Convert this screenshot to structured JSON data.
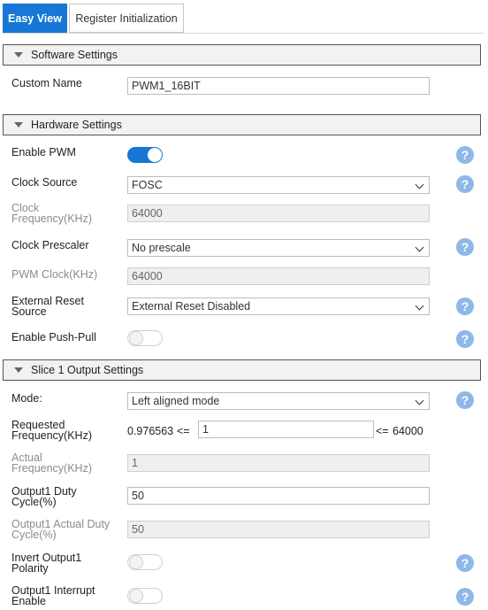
{
  "tabs": [
    {
      "label": "Easy View"
    },
    {
      "label": "Register Initialization"
    }
  ],
  "software": {
    "title": "Software Settings",
    "custom_name_label": "Custom Name",
    "custom_name_value": "PWM1_16BIT"
  },
  "hardware": {
    "title": "Hardware Settings",
    "enable_pwm_label": "Enable PWM",
    "enable_pwm_on": true,
    "clock_source_label": "Clock Source",
    "clock_source_value": "FOSC",
    "clock_freq_label_1": "Clock",
    "clock_freq_label_2": "Frequency(KHz)",
    "clock_freq_value": "64000",
    "clock_prescaler_label": "Clock Prescaler",
    "clock_prescaler_value": "No prescale",
    "pwm_clock_label": "PWM Clock(KHz)",
    "pwm_clock_value": "64000",
    "ext_reset_label_1": "External Reset",
    "ext_reset_label_2": "Source",
    "ext_reset_value": "External Reset Disabled",
    "push_pull_label": "Enable Push-Pull",
    "push_pull_on": false
  },
  "slice1": {
    "title": "Slice 1 Output Settings",
    "mode_label": "Mode:",
    "mode_value": "Left aligned mode",
    "req_freq_label_1": "Requested",
    "req_freq_label_2": "Frequency(KHz)",
    "req_freq_min": "0.976563",
    "req_freq_le1": "<=",
    "req_freq_value": "1",
    "req_freq_le2": "<=",
    "req_freq_max": "64000",
    "actual_freq_label_1": "Actual",
    "actual_freq_label_2": "Frequency(KHz)",
    "actual_freq_value": "1",
    "duty_label_1": "Output1 Duty",
    "duty_label_2": "Cycle(%)",
    "duty_value": "50",
    "actual_duty_label_1": "Output1 Actual Duty",
    "actual_duty_label_2": "Cycle(%)",
    "actual_duty_value": "50",
    "invert_label_1": "Invert Output1",
    "invert_label_2": "Polarity",
    "invert_on": false,
    "interrupt_label_1": "Output1 Interrupt",
    "interrupt_label_2": "Enable",
    "interrupt_on": false
  },
  "help_glyph": "?",
  "icons": {
    "help": "help-icon",
    "collapse": "triangle-down-icon",
    "dropdown": "chevron-down-icon"
  },
  "colors": {
    "accent": "#1677d6",
    "help": "#8db8e8"
  }
}
